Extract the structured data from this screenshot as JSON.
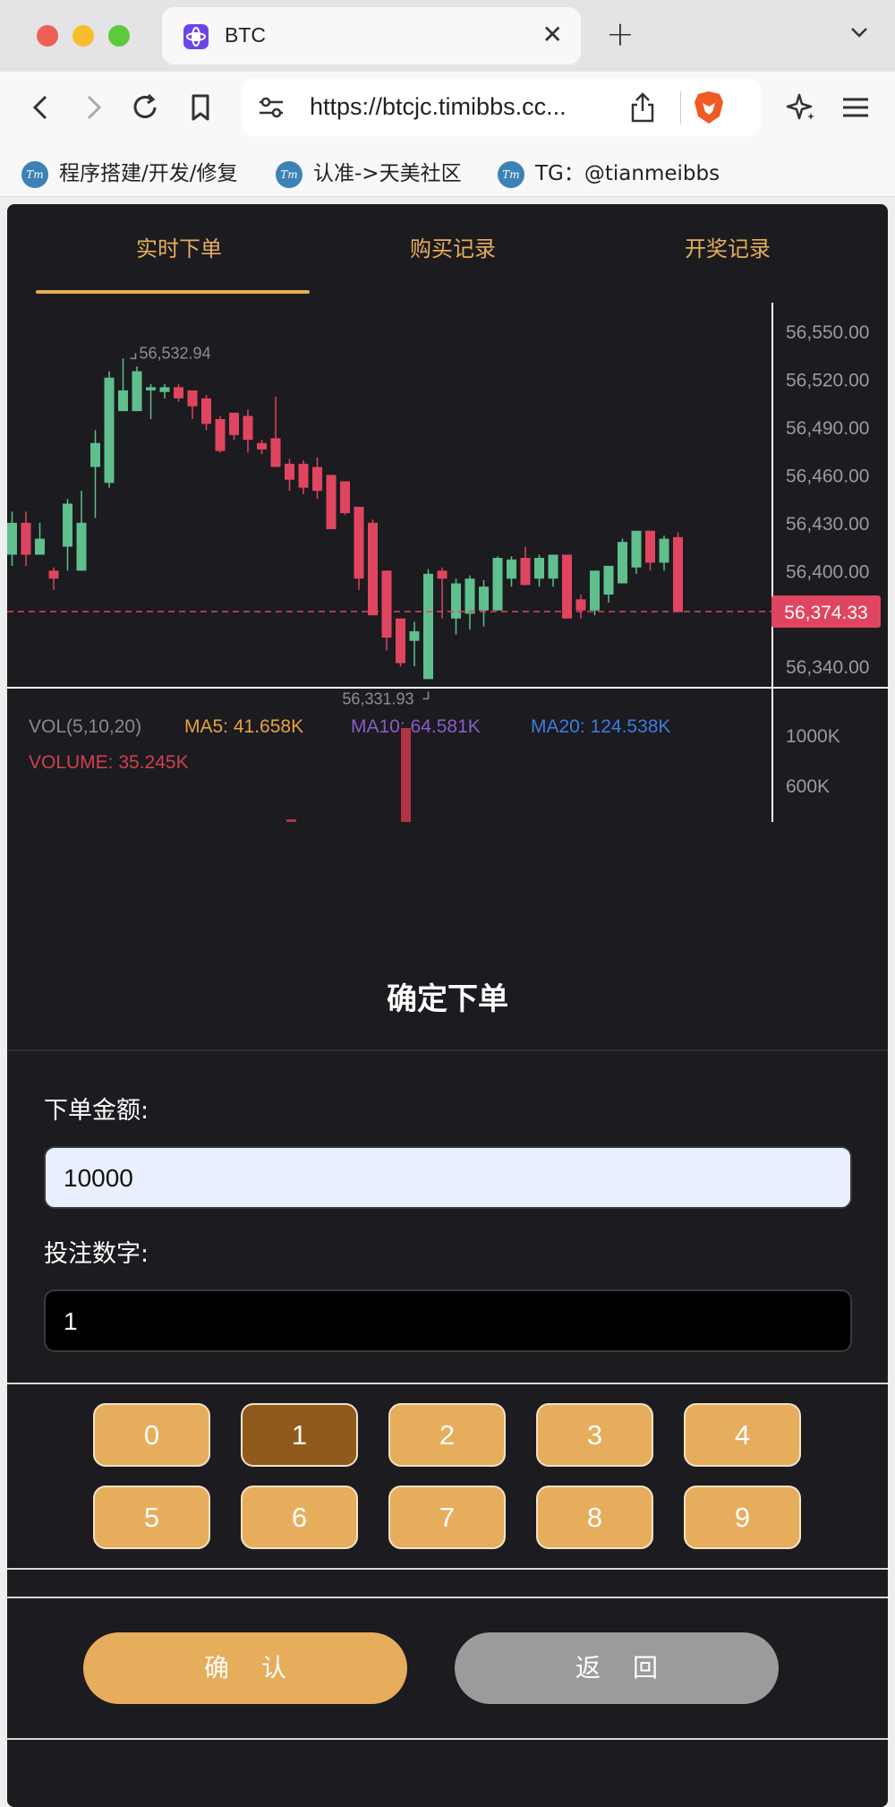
{
  "browser": {
    "tab_title": "BTC",
    "tab_close": "✕",
    "new_tab": "+",
    "url": "https://btcjc.timibbs.cc...",
    "bookmarks": [
      {
        "icon_text": "Tm",
        "label": "程序搭建/开发/修复"
      },
      {
        "icon_text": "Tm",
        "label": "认准->天美社区"
      },
      {
        "icon_text": "Tm",
        "label": "TG：@tianmeibbs"
      }
    ]
  },
  "nav": {
    "tabs": [
      "实时下单",
      "购买记录",
      "开奖记录"
    ],
    "active_tab": 0
  },
  "chart_data": {
    "type": "candlestick",
    "price_axis": [
      "56,550.00",
      "56,520.00",
      "56,490.00",
      "56,460.00",
      "56,430.00",
      "56,400.00",
      "56,340.00"
    ],
    "y_range": [
      56321,
      56568
    ],
    "high_marker": "56,532.94",
    "low_marker": "56,331.93",
    "last_price": "56,374.33",
    "last_price_value": 56374.33,
    "up_color": "#5fbf8d",
    "down_color": "#e0455f",
    "candles": [
      {
        "o": 56410,
        "c": 56430,
        "h": 56437,
        "l": 56403
      },
      {
        "o": 56430,
        "c": 56410,
        "h": 56437,
        "l": 56403
      },
      {
        "o": 56410,
        "c": 56420,
        "h": 56430,
        "l": 56410
      },
      {
        "o": 56400,
        "c": 56395,
        "h": 56402,
        "l": 56388
      },
      {
        "o": 56415,
        "c": 56442,
        "h": 56445,
        "l": 56400
      },
      {
        "o": 56400,
        "c": 56430,
        "h": 56450,
        "l": 56400
      },
      {
        "o": 56465,
        "c": 56480,
        "h": 56488,
        "l": 56433
      },
      {
        "o": 56455,
        "c": 56521,
        "h": 56525,
        "l": 56452
      },
      {
        "o": 56500,
        "c": 56513,
        "h": 56533,
        "l": 56500
      },
      {
        "o": 56500,
        "c": 56525,
        "h": 56528,
        "l": 56500
      },
      {
        "o": 56513,
        "c": 56515,
        "h": 56517,
        "l": 56495
      },
      {
        "o": 56512,
        "c": 56515,
        "h": 56517,
        "l": 56508
      },
      {
        "o": 56515,
        "c": 56508,
        "h": 56517,
        "l": 56506
      },
      {
        "o": 56513,
        "c": 56503,
        "h": 56513,
        "l": 56495
      },
      {
        "o": 56508,
        "c": 56492,
        "h": 56510,
        "l": 56488
      },
      {
        "o": 56495,
        "c": 56475,
        "h": 56497,
        "l": 56474
      },
      {
        "o": 56499,
        "c": 56485,
        "h": 56499,
        "l": 56482
      },
      {
        "o": 56497,
        "c": 56482,
        "h": 56501,
        "l": 56474
      },
      {
        "o": 56480,
        "c": 56476,
        "h": 56482,
        "l": 56473
      },
      {
        "o": 56483,
        "c": 56465,
        "h": 56509,
        "l": 56465
      },
      {
        "o": 56467,
        "c": 56457,
        "h": 56470,
        "l": 56450
      },
      {
        "o": 56467,
        "c": 56452,
        "h": 56469,
        "l": 56448
      },
      {
        "o": 56465,
        "c": 56450,
        "h": 56471,
        "l": 56445
      },
      {
        "o": 56460,
        "c": 56426,
        "h": 56460,
        "l": 56426
      },
      {
        "o": 56456,
        "c": 56436,
        "h": 56456,
        "l": 56435
      },
      {
        "o": 56440,
        "c": 56395,
        "h": 56440,
        "l": 56388
      },
      {
        "o": 56430,
        "c": 56372,
        "h": 56432,
        "l": 56372
      },
      {
        "o": 56400,
        "c": 56358,
        "h": 56400,
        "l": 56350
      },
      {
        "o": 56370,
        "c": 56342,
        "h": 56370,
        "l": 56340
      },
      {
        "o": 56356,
        "c": 56362,
        "h": 56368,
        "l": 56340
      },
      {
        "o": 56332,
        "c": 56398,
        "h": 56401,
        "l": 56332
      },
      {
        "o": 56400,
        "c": 56395,
        "h": 56402,
        "l": 56370
      },
      {
        "o": 56370,
        "c": 56392,
        "h": 56395,
        "l": 56360
      },
      {
        "o": 56373,
        "c": 56395,
        "h": 56397,
        "l": 56363
      },
      {
        "o": 56375,
        "c": 56390,
        "h": 56394,
        "l": 56365
      },
      {
        "o": 56375,
        "c": 56408,
        "h": 56409,
        "l": 56375
      },
      {
        "o": 56395,
        "c": 56407,
        "h": 56409,
        "l": 56390
      },
      {
        "o": 56408,
        "c": 56391,
        "h": 56415,
        "l": 56391
      },
      {
        "o": 56395,
        "c": 56408,
        "h": 56410,
        "l": 56390
      },
      {
        "o": 56395,
        "c": 56410,
        "h": 56410,
        "l": 56390
      },
      {
        "o": 56410,
        "c": 56370,
        "h": 56410,
        "l": 56370
      },
      {
        "o": 56382,
        "c": 56375,
        "h": 56385,
        "l": 56370
      },
      {
        "o": 56375,
        "c": 56400,
        "h": 56400,
        "l": 56372
      },
      {
        "o": 56385,
        "c": 56403,
        "h": 56403,
        "l": 56380
      },
      {
        "o": 56392,
        "c": 56418,
        "h": 56420,
        "l": 56392
      },
      {
        "o": 56402,
        "c": 56425,
        "h": 56425,
        "l": 56398
      },
      {
        "o": 56425,
        "c": 56405,
        "h": 56425,
        "l": 56400
      },
      {
        "o": 56405,
        "c": 56420,
        "h": 56422,
        "l": 56400
      },
      {
        "o": 56421,
        "c": 56374,
        "h": 56424,
        "l": 56374
      }
    ],
    "volume_axis": [
      "1000K",
      "600K"
    ],
    "volume_labels": {
      "vol": "VOL(5,10,20)",
      "ma5": "MA5: 41.658K",
      "ma10": "MA10: 64.581K",
      "ma20": "MA20: 124.538K",
      "volume": "VOLUME: 35.245K"
    },
    "colors": {
      "ma5": "#e8a33f",
      "ma10": "#8a5cc4",
      "ma20": "#3f7be0",
      "volume": "#d0404f",
      "vol": "#8a8a8a"
    }
  },
  "order": {
    "title": "确定下单",
    "amount_label": "下单金额:",
    "amount_value": "10000",
    "number_label": "投注数字:",
    "number_value": "1",
    "digits": [
      "0",
      "1",
      "2",
      "3",
      "4",
      "5",
      "6",
      "7",
      "8",
      "9"
    ],
    "selected_digit": "1",
    "confirm_label": "确认",
    "back_label": "返回"
  }
}
